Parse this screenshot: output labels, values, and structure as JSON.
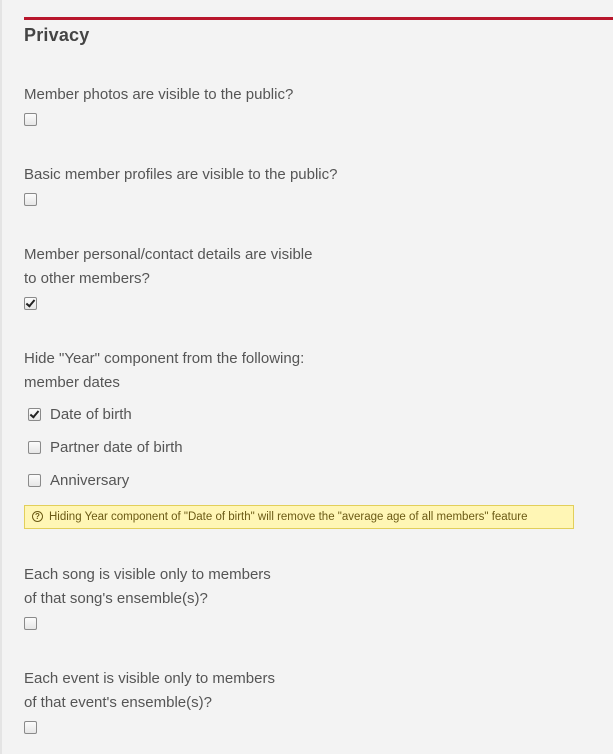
{
  "section": {
    "title": "Privacy"
  },
  "questions": [
    {
      "lines": [
        "Member photos are visible to the public?"
      ],
      "checked": false
    },
    {
      "lines": [
        "Basic member profiles are visible to the public?"
      ],
      "checked": false
    },
    {
      "lines": [
        "Member personal/contact details are visible",
        "to other members?"
      ],
      "checked": true
    },
    {
      "lines": [
        "Hide \"Year\" component from the following:",
        "member dates"
      ]
    },
    {
      "lines": [
        "Each song is visible only to members",
        "of that song's ensemble(s)?"
      ],
      "checked": false
    },
    {
      "lines": [
        "Each event is visible only to members",
        "of that event's ensemble(s)?"
      ],
      "checked": false
    }
  ],
  "year_options": [
    {
      "label": "Date of birth",
      "checked": true
    },
    {
      "label": "Partner date of birth",
      "checked": false
    },
    {
      "label": "Anniversary",
      "checked": false
    }
  ],
  "notice": {
    "icon": "question-circle-icon",
    "text": "Hiding Year component of \"Date of birth\" will remove the \"average age of all members\" feature"
  },
  "colors": {
    "accent": "#b8162c",
    "notice_bg": "#fff6b5",
    "notice_border": "#e2cf5a"
  }
}
